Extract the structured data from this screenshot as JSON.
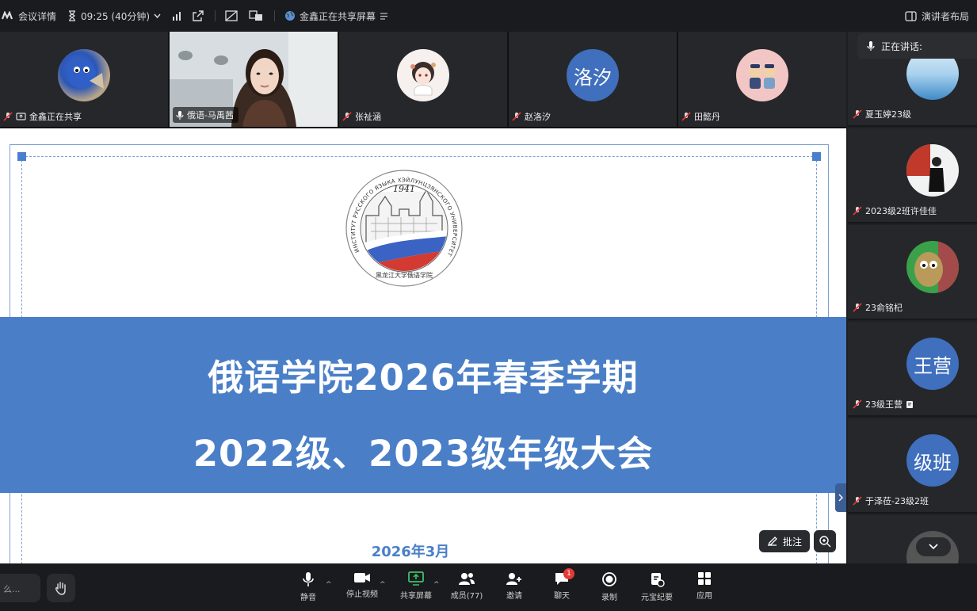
{
  "topbar": {
    "meeting_details": "会议详情",
    "duration": "09:25 (40分钟)",
    "sharing_status": "金鑫正在共享屏幕",
    "layout_label": "演讲者布局"
  },
  "tiles": [
    {
      "name": "金鑫正在共享"
    },
    {
      "name": "俄语-马禹茜"
    },
    {
      "name": "张祉涵"
    },
    {
      "name": "赵洛汐",
      "avatar_text": "洛汐"
    },
    {
      "name": "田懿丹"
    }
  ],
  "sidebar": {
    "speaking_label": "正在讲话:",
    "participants": [
      {
        "name": "夏玉婷23级"
      },
      {
        "name": "2023级2班许佳佳"
      },
      {
        "name": "23俞铭杞"
      },
      {
        "name": "23级王营",
        "avatar_text": "王营"
      },
      {
        "name": "于泽莅-23级2班",
        "avatar_text": "级班"
      }
    ]
  },
  "slide": {
    "logo": {
      "year": "1941",
      "ring_text": "ИНСТИТУТ РУССКОГО ЯЗЫКА ХЭЙЛУНЦЗЯНСКОГО УНИВЕРСИТЕТА",
      "bottom_text": "黑龙江大学俄语学院"
    },
    "title_line1": "俄语学院2026年春季学期",
    "title_line2": "2022级、2023级年级大会",
    "date": "2026年3月",
    "annotate_label": "批注"
  },
  "toolbar": {
    "chat_placeholder": "么...",
    "mute": "静音",
    "stop_video": "停止视频",
    "share_screen": "共享屏幕",
    "members": "成员(77)",
    "invite": "邀请",
    "chat": "聊天",
    "chat_badge": "1",
    "record": "录制",
    "yuanbao": "元宝纪要",
    "apps": "应用"
  },
  "colors": {
    "accent": "#4a7fc8",
    "badge": "#e53935"
  }
}
